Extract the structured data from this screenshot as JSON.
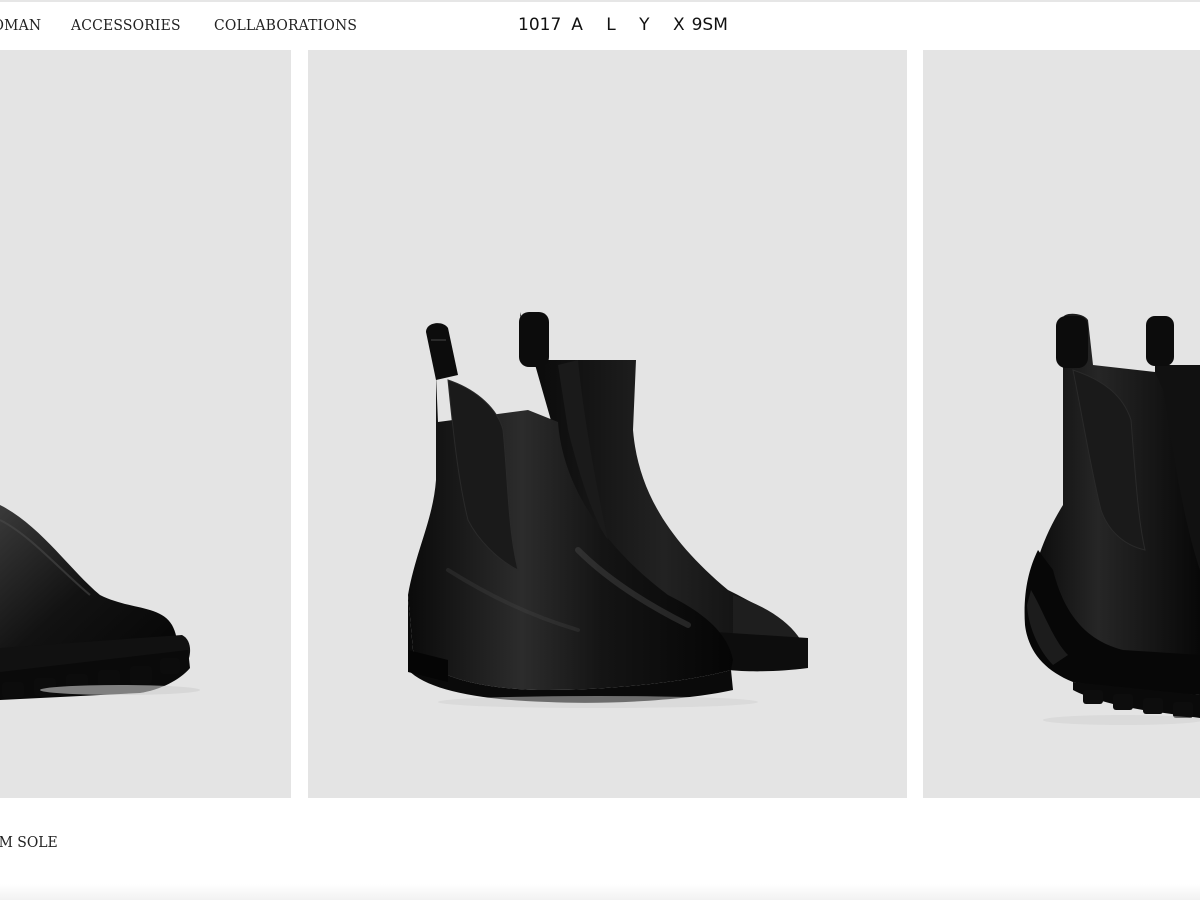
{
  "header": {
    "nav": [
      {
        "label": "WOMAN"
      },
      {
        "label": "ACCESSORIES"
      },
      {
        "label": "COLLABORATIONS"
      }
    ],
    "logo": {
      "prefix": "1017",
      "letters": "A L Y X",
      "suffix": "9SM"
    }
  },
  "products": [
    {
      "image": "black-leather-chelsea-boot-lug-sole-icon",
      "caption": "…RAM SOLE"
    },
    {
      "image": "black-leather-chelsea-boots-pair-icon"
    },
    {
      "image": "black-chelsea-boots-vibram-sole-icon"
    }
  ],
  "caption_visible": "RAM SOLE",
  "colors": {
    "background": "#ffffff",
    "image_bg": "#e4e4e4",
    "boot": "#0f0f0f",
    "text": "#222222"
  }
}
